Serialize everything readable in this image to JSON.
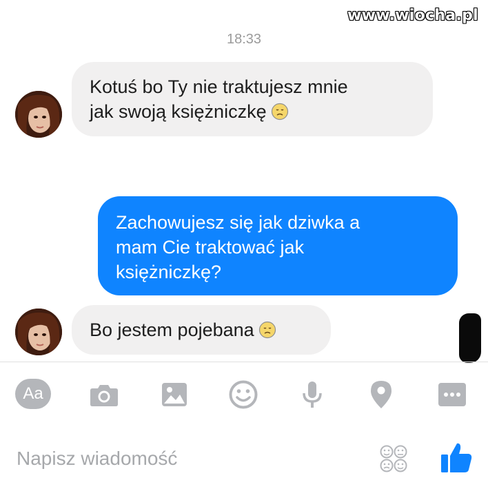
{
  "watermark": {
    "text": "www.wiocha.pl"
  },
  "conversation": {
    "timestamp": "18:33",
    "messages": [
      {
        "direction": "incoming",
        "lines": [
          "Kotuś bo Ty nie traktujesz mnie",
          "jak swoją księżniczkę"
        ],
        "emoji": "sad-face-emoji"
      },
      {
        "direction": "outgoing",
        "lines": [
          "Zachowujesz się jak dziwka a",
          "mam Cie traktować jak",
          "księżniczkę?"
        ]
      },
      {
        "direction": "incoming",
        "lines": [
          "Bo jestem pojebana"
        ],
        "emoji": "sad-face-emoji"
      }
    ]
  },
  "toolbar": {
    "aa_label": "Aa",
    "icons": [
      "camera-icon",
      "image-icon",
      "emoji-icon",
      "microphone-icon",
      "location-icon",
      "more-icon"
    ]
  },
  "composer": {
    "placeholder": "Napisz wiadomość",
    "sticker_icon": "sticker-icon",
    "like_icon": "thumbs-up-icon"
  },
  "colors": {
    "outgoing_bubble": "#0f84ff",
    "incoming_bubble": "#f1f0f0",
    "icon_gray": "#b4b6ba",
    "like_blue": "#0f84ff"
  }
}
